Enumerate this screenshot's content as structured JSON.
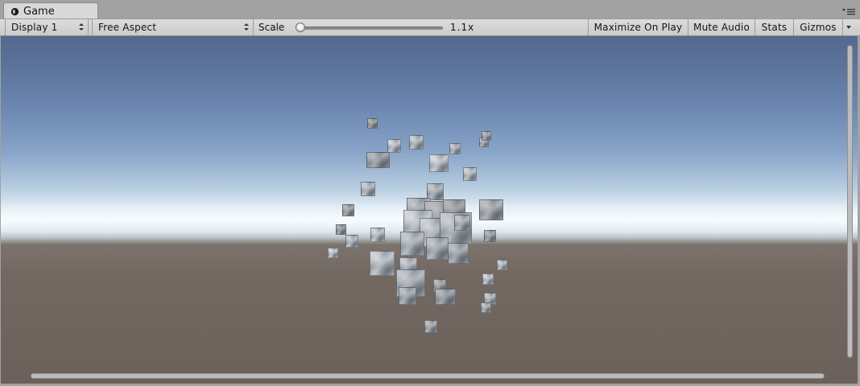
{
  "window": {
    "tab_label": "Game",
    "tab_icon": "game-controller-icon",
    "menu_icon": "window-menu-icon"
  },
  "toolbar": {
    "display_select": "Display 1",
    "aspect_select": "Free Aspect",
    "scale_label": "Scale",
    "scale_value": "1.1x",
    "scale_fraction": 0.02,
    "maximize_on_play": "Maximize On Play",
    "mute_audio": "Mute Audio",
    "stats": "Stats",
    "gizmos": "Gizmos"
  },
  "viewport": {
    "scene": "floating stone cubes over skybox and ground",
    "sky_top_color": "#53698f",
    "horizon_color": "#f4f8fb",
    "ground_color": "#6b605a"
  }
}
